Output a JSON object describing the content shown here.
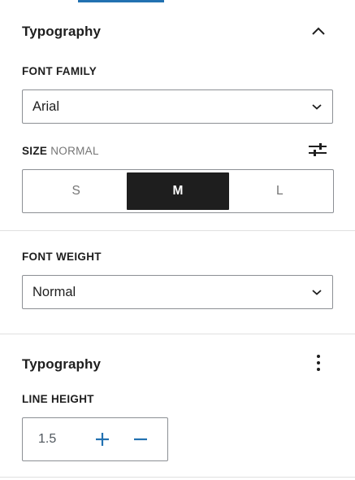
{
  "colors": {
    "accent": "#2271b1",
    "text": "#1e1e1e",
    "muted": "#757575",
    "border": "#8c8f94",
    "divider": "#e0e0e0",
    "active_bg": "#1e1e1e",
    "active_text": "#ffffff"
  },
  "typography_panel": {
    "title": "Typography",
    "toggle_icon": "chevron-up-icon",
    "font_family": {
      "label": "FONT FAMILY",
      "value": "Arial",
      "icon": "chevron-down-icon"
    },
    "size": {
      "label": "SIZE",
      "current": "NORMAL",
      "settings_icon": "sliders-icon",
      "options": [
        "S",
        "M",
        "L"
      ],
      "selected": "M"
    }
  },
  "font_weight_panel": {
    "label": "FONT WEIGHT",
    "value": "Normal",
    "icon": "chevron-down-icon"
  },
  "typography_panel_2": {
    "title": "Typography",
    "menu_icon": "more-vertical-icon",
    "line_height": {
      "label": "LINE HEIGHT",
      "value": "1.5",
      "increment_icon": "plus-icon",
      "decrement_icon": "minus-icon"
    }
  }
}
